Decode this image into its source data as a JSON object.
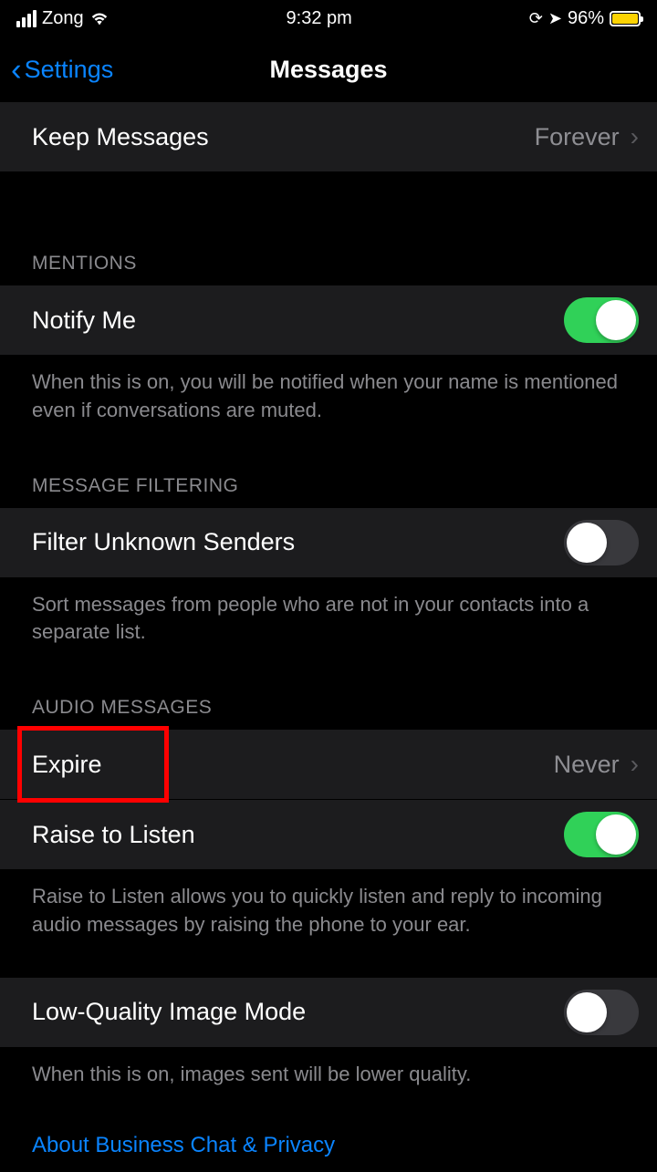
{
  "status": {
    "carrier": "Zong",
    "time": "9:32 pm",
    "battery_pct": "96%"
  },
  "nav": {
    "back_label": "Settings",
    "title": "Messages"
  },
  "rows": {
    "keep_messages": {
      "label": "Keep Messages",
      "value": "Forever"
    },
    "notify_me": {
      "label": "Notify Me"
    },
    "filter_unknown": {
      "label": "Filter Unknown Senders"
    },
    "expire": {
      "label": "Expire",
      "value": "Never"
    },
    "raise_listen": {
      "label": "Raise to Listen"
    },
    "low_quality": {
      "label": "Low-Quality Image Mode"
    }
  },
  "sections": {
    "mentions": "MENTIONS",
    "filtering": "MESSAGE FILTERING",
    "audio": "AUDIO MESSAGES"
  },
  "footers": {
    "mentions": "When this is on, you will be notified when your name is mentioned even if conversations are muted.",
    "filtering": "Sort messages from people who are not in your contacts into a separate list.",
    "raise": "Raise to Listen allows you to quickly listen and reply to incoming audio messages by raising the phone to your ear.",
    "low_quality": "When this is on, images sent will be lower quality."
  },
  "links": {
    "about": "About Business Chat & Privacy"
  }
}
